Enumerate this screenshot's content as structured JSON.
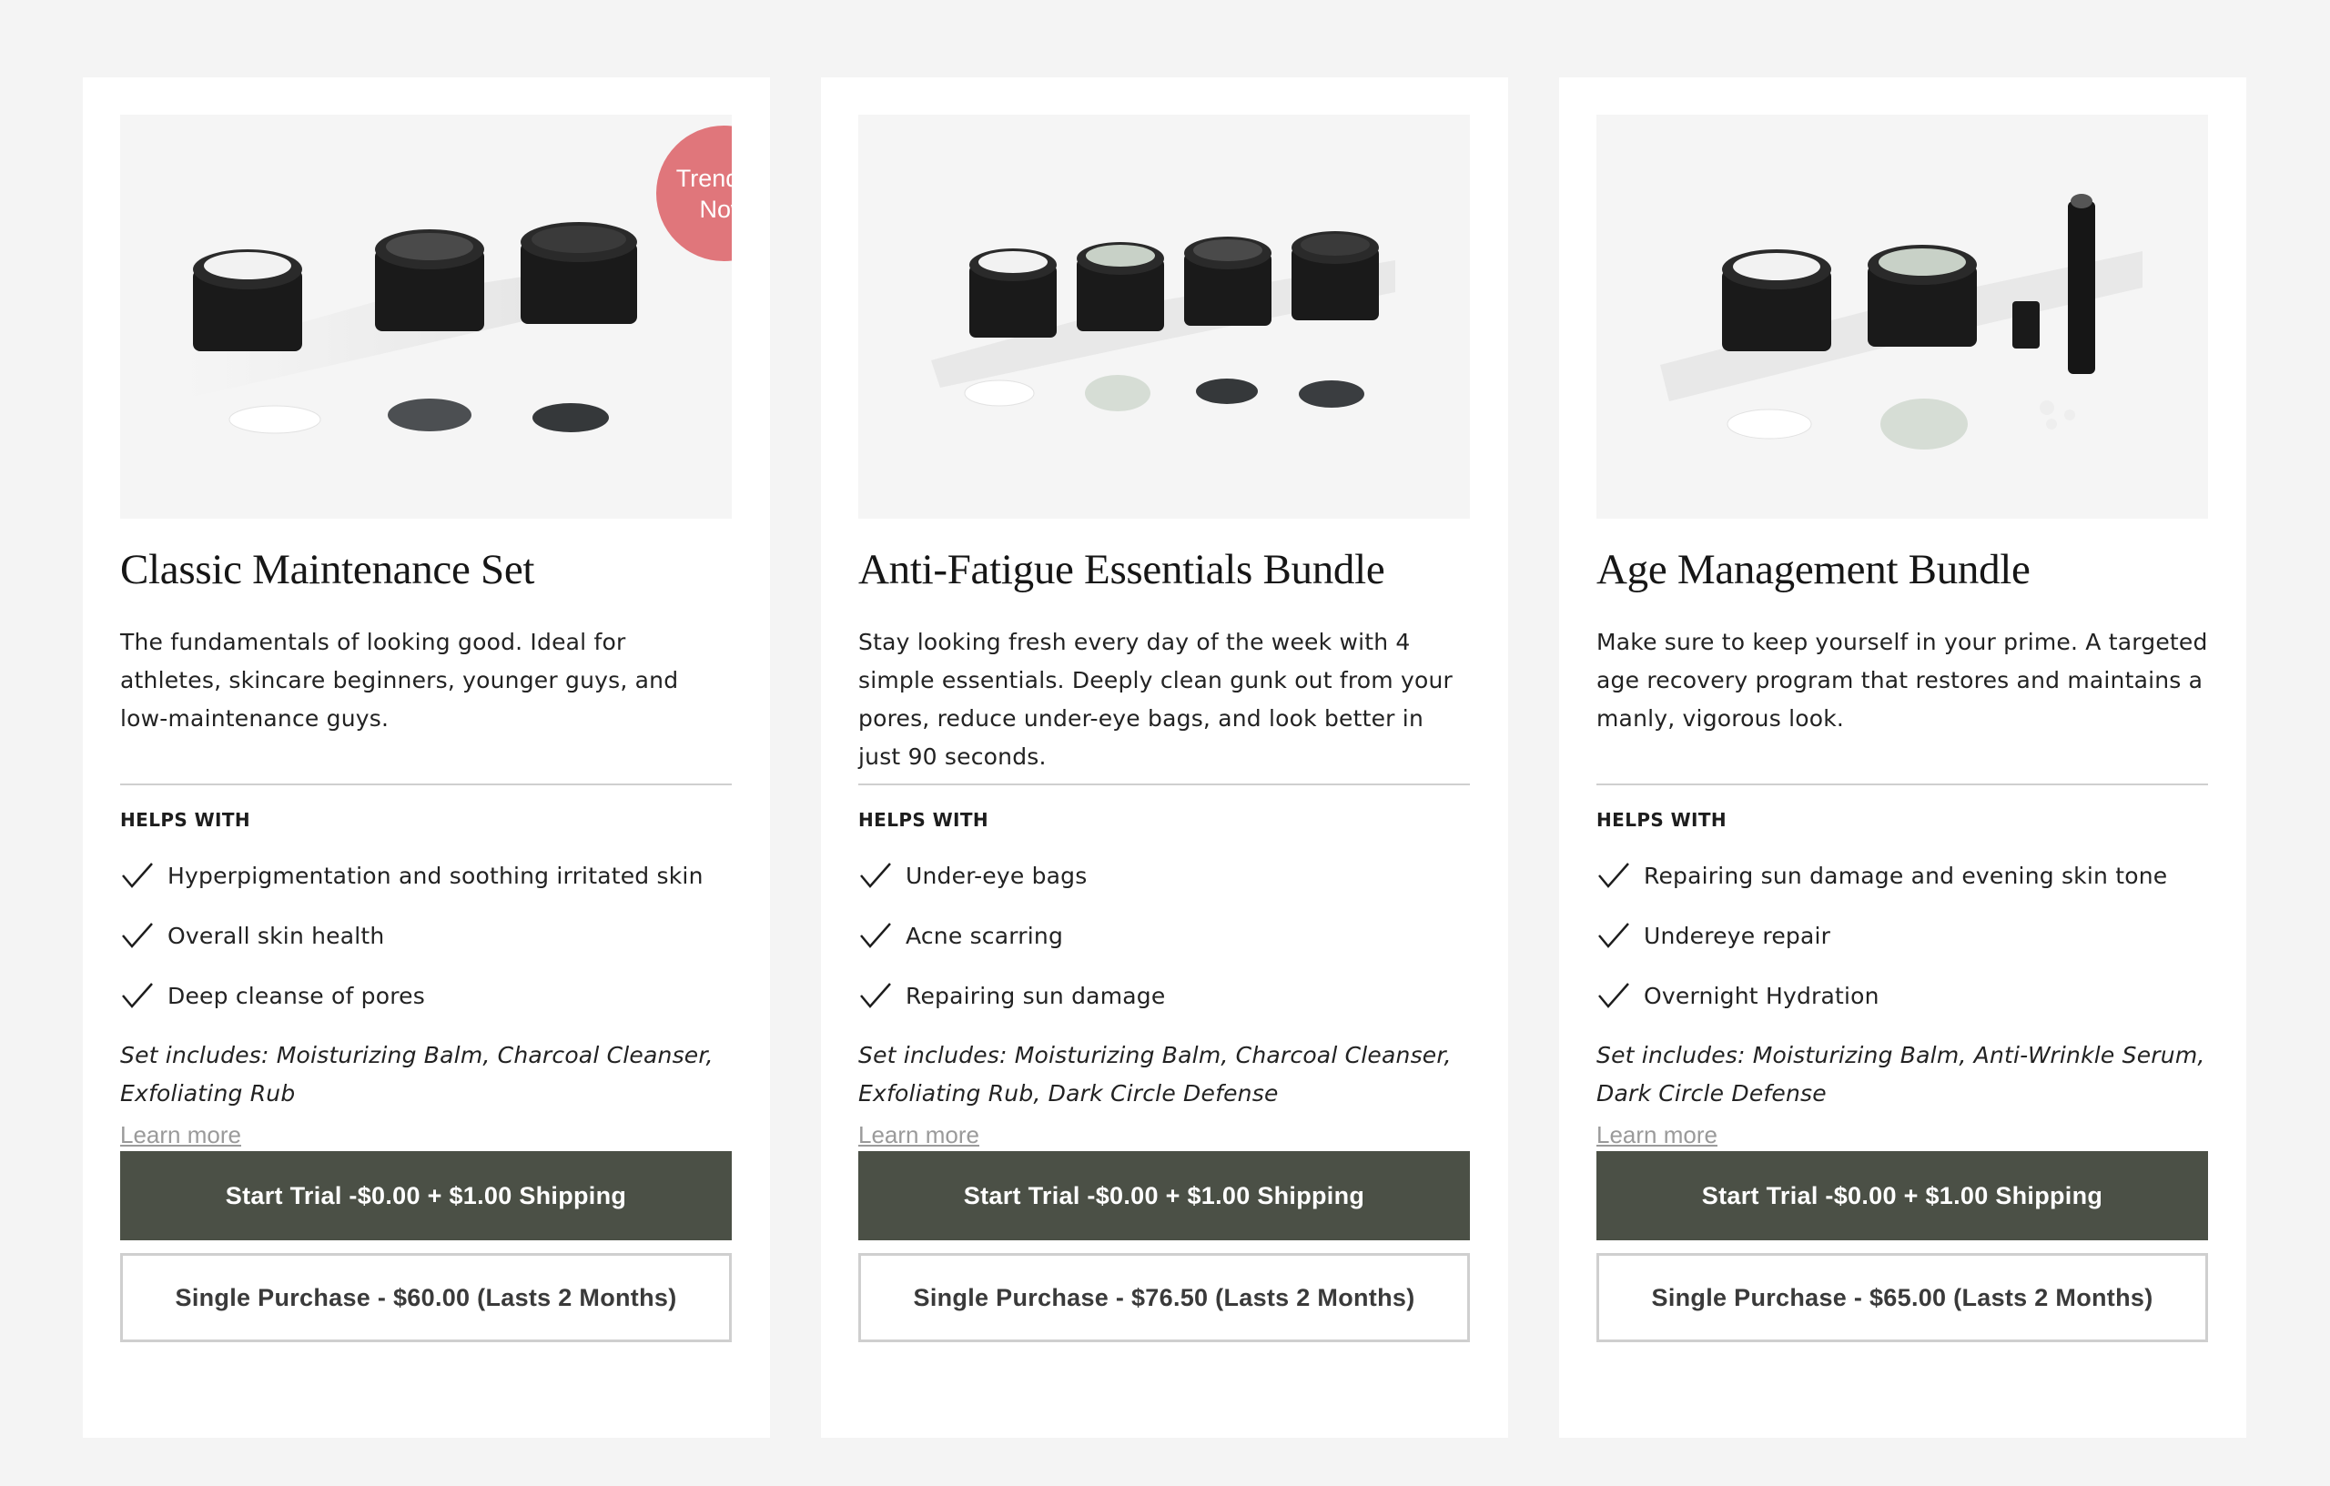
{
  "colors": {
    "page_background": "#f4f4f4",
    "card_background": "#ffffff",
    "trial_button": "#4b5046",
    "badge": "#e0767b",
    "link": "#9a9a9a"
  },
  "cards": [
    {
      "badge": "Trending Now",
      "image_alt": "Three black jars: Moisturizing Balm, Charcoal Cleanser, Exfoliating Rub",
      "title": "Classic Maintenance Set",
      "description": "The fundamentals of looking good. Ideal for athletes, skincare beginners, younger guys, and low-maintenance guys.",
      "helps_label": "HELPS WITH",
      "helps": [
        "Hyperpigmentation and soothing irritated skin",
        "Overall skin health",
        "Deep cleanse of pores"
      ],
      "includes": "Set includes: Moisturizing Balm, Charcoal Cleanser, Exfoliating Rub",
      "learn_more": "Learn more",
      "trial_button": "Start Trial -$0.00 + $1.00 Shipping",
      "single_button": "Single Purchase - $60.00 (Lasts 2 Months)"
    },
    {
      "image_alt": "Four black jars: Moisturizing Balm, Dark Circle Defense, Exfoliating Rub, Charcoal Cleanser",
      "title": "Anti-Fatigue Essentials Bundle",
      "description": "Stay looking fresh every day of the week with 4 simple essentials. Deeply clean gunk out from your pores, reduce under-eye bags, and look better in just 90 seconds.",
      "helps_label": "HELPS WITH",
      "helps": [
        "Under-eye bags",
        "Acne scarring",
        "Repairing sun damage"
      ],
      "includes": "Set includes: Moisturizing Balm, Charcoal Cleanser, Exfoliating Rub, Dark Circle Defense",
      "learn_more": "Learn more",
      "trial_button": "Start Trial -$0.00 + $1.00 Shipping",
      "single_button": "Single Purchase - $76.50 (Lasts 2 Months)"
    },
    {
      "image_alt": "Two black jars and a serum pen: Moisturizing Balm, Dark Circle Defense, Anti-Wrinkle Serum",
      "title": "Age Management Bundle",
      "description": "Make sure to keep yourself in your prime. A targeted age recovery program that restores and maintains a manly, vigorous look.",
      "helps_label": "HELPS WITH",
      "helps": [
        "Repairing sun damage and evening skin tone",
        "Undereye repair",
        "Overnight Hydration"
      ],
      "includes": "Set includes: Moisturizing Balm, Anti-Wrinkle Serum, Dark Circle Defense",
      "learn_more": "Learn more",
      "trial_button": "Start Trial -$0.00 + $1.00 Shipping",
      "single_button": "Single Purchase - $65.00 (Lasts 2 Months)"
    }
  ]
}
